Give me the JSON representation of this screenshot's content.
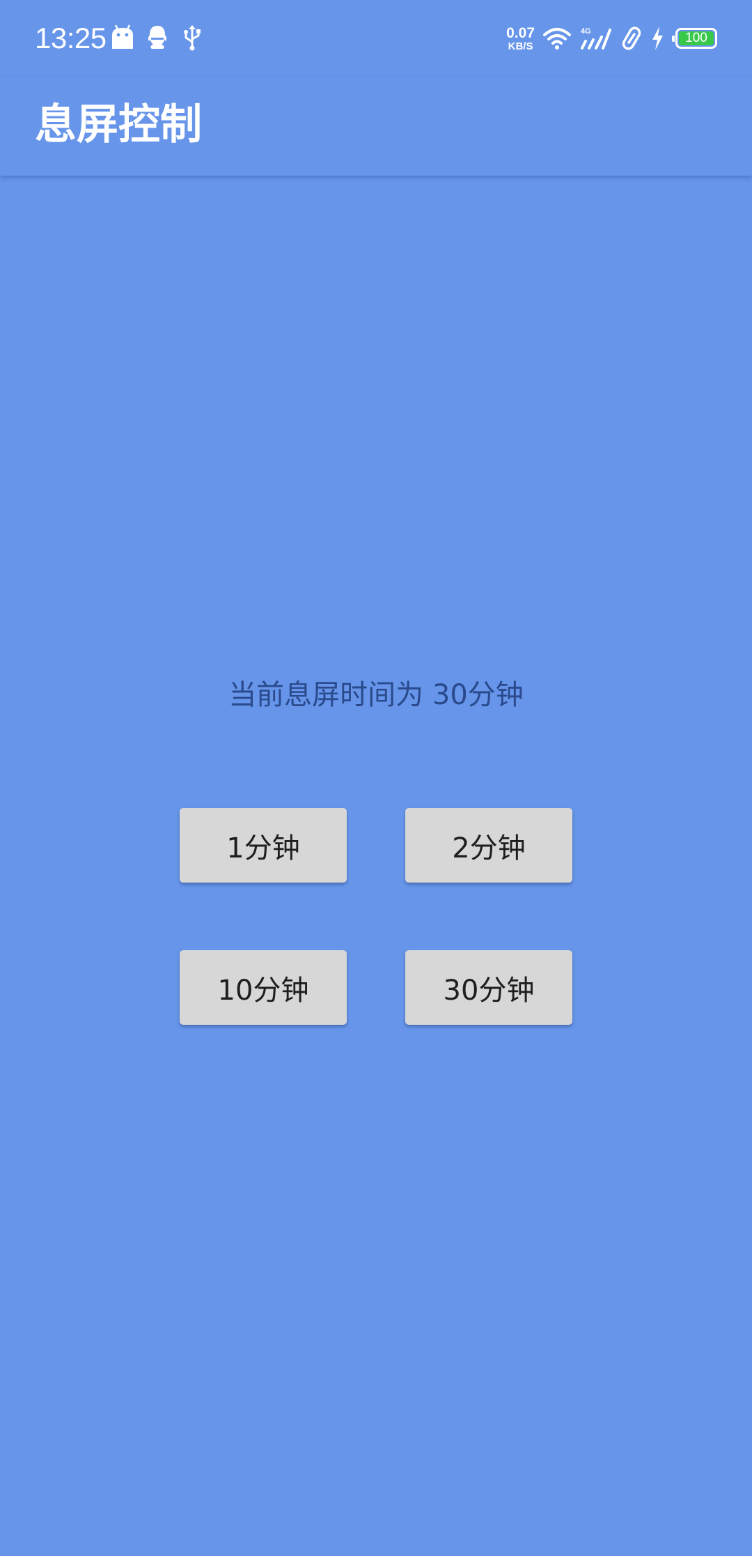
{
  "status_bar": {
    "time": "13:25",
    "left_icons": [
      "android-icon",
      "qq-icon",
      "usb-icon"
    ],
    "net_speed_value": "0.07",
    "net_speed_unit": "KB/S",
    "right_icons": [
      "wifi-icon",
      "signal-4g-icon",
      "link-icon",
      "charging-icon"
    ],
    "battery_level": "100"
  },
  "app_bar": {
    "title": "息屏控制"
  },
  "main": {
    "current_label": "当前息屏时间为",
    "current_value": "30分钟",
    "buttons": [
      {
        "label": "1分钟"
      },
      {
        "label": "2分钟"
      },
      {
        "label": "10分钟"
      },
      {
        "label": "30分钟"
      }
    ]
  },
  "colors": {
    "background": "#6695ea",
    "button": "#d7d7d7",
    "status_text": "#2a4a8c",
    "battery_fill": "#39c94a"
  }
}
